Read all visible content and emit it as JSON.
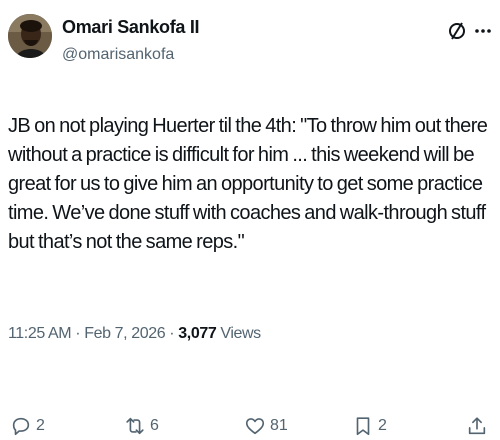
{
  "author": {
    "display_name": "Omari Sankofa II",
    "handle": "@omarisankofa"
  },
  "tweet": {
    "text": "JB on not playing Huerter til the 4th: \"To throw him out there without a practice is difficult for him ... this weekend will be great for us to give him an opportunity to get some practice time. We’ve done stuff with coaches and walk-through stuff but that’s not the same reps.\"",
    "time": "11:25 AM",
    "date": "Feb 7, 2026",
    "views_count": "3,077",
    "views_label": "Views"
  },
  "actions": {
    "replies": "2",
    "reposts": "6",
    "likes": "81",
    "bookmarks": "2"
  },
  "icons": {
    "grok": "grok-icon",
    "more": "more-icon",
    "reply": "reply-icon",
    "retweet": "retweet-icon",
    "like": "heart-icon",
    "bookmark": "bookmark-icon",
    "share": "share-icon"
  },
  "colors": {
    "text_primary": "#0f1419",
    "text_secondary": "#536471"
  }
}
